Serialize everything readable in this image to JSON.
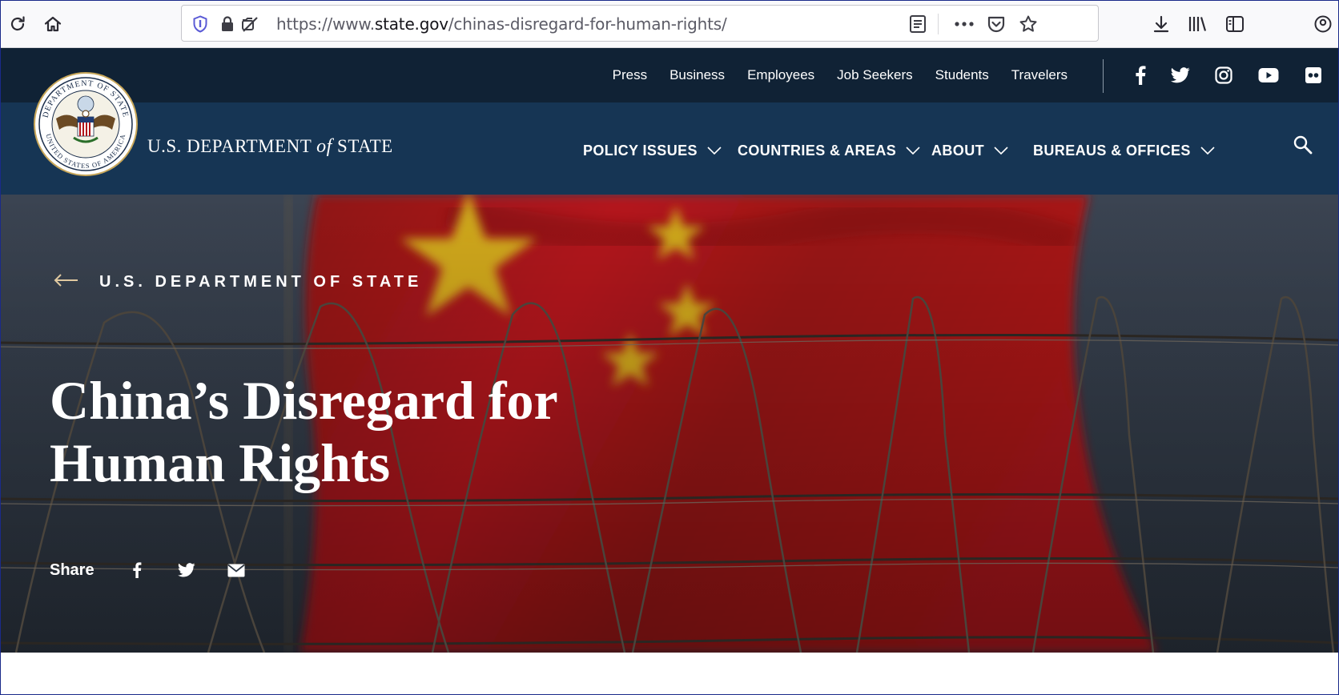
{
  "browser": {
    "url_prefix": "https://www.",
    "url_host": "state.gov",
    "url_path": "/chinas-disregard-for-human-rights/",
    "icons": [
      "reload-icon",
      "home-icon",
      "shield-icon",
      "lock-icon",
      "permissions-icon",
      "reader-view-icon",
      "more-icon",
      "pocket-icon",
      "bookmark-star-icon",
      "download-icon",
      "library-icon",
      "sidebar-icon",
      "account-icon"
    ]
  },
  "utility_nav": {
    "links": [
      "Press",
      "Business",
      "Employees",
      "Job Seekers",
      "Students",
      "Travelers"
    ],
    "social_icons": [
      "facebook-icon",
      "twitter-icon",
      "instagram-icon",
      "youtube-icon",
      "flickr-icon"
    ]
  },
  "header": {
    "dept_part1": "U.S. DEPARTMENT",
    "dept_of": "of",
    "dept_part2": "STATE",
    "seal_text_top": "DEPARTMENT OF STATE",
    "seal_text_bottom": "UNITED STATES OF AMERICA"
  },
  "main_menu": {
    "items": [
      "POLICY ISSUES",
      "COUNTRIES & AREAS",
      "ABOUT",
      "BUREAUS & OFFICES"
    ]
  },
  "hero": {
    "breadcrumb": "U.S. DEPARTMENT OF STATE",
    "title": "China’s Disregard for Human Rights",
    "share_label": "Share",
    "share_icons": [
      "facebook-icon",
      "twitter-icon",
      "email-icon"
    ]
  },
  "colors": {
    "top_bar": "#102235",
    "main_nav": "#163554",
    "flag_red": "#b0141a",
    "flag_star": "#e0c21c"
  }
}
